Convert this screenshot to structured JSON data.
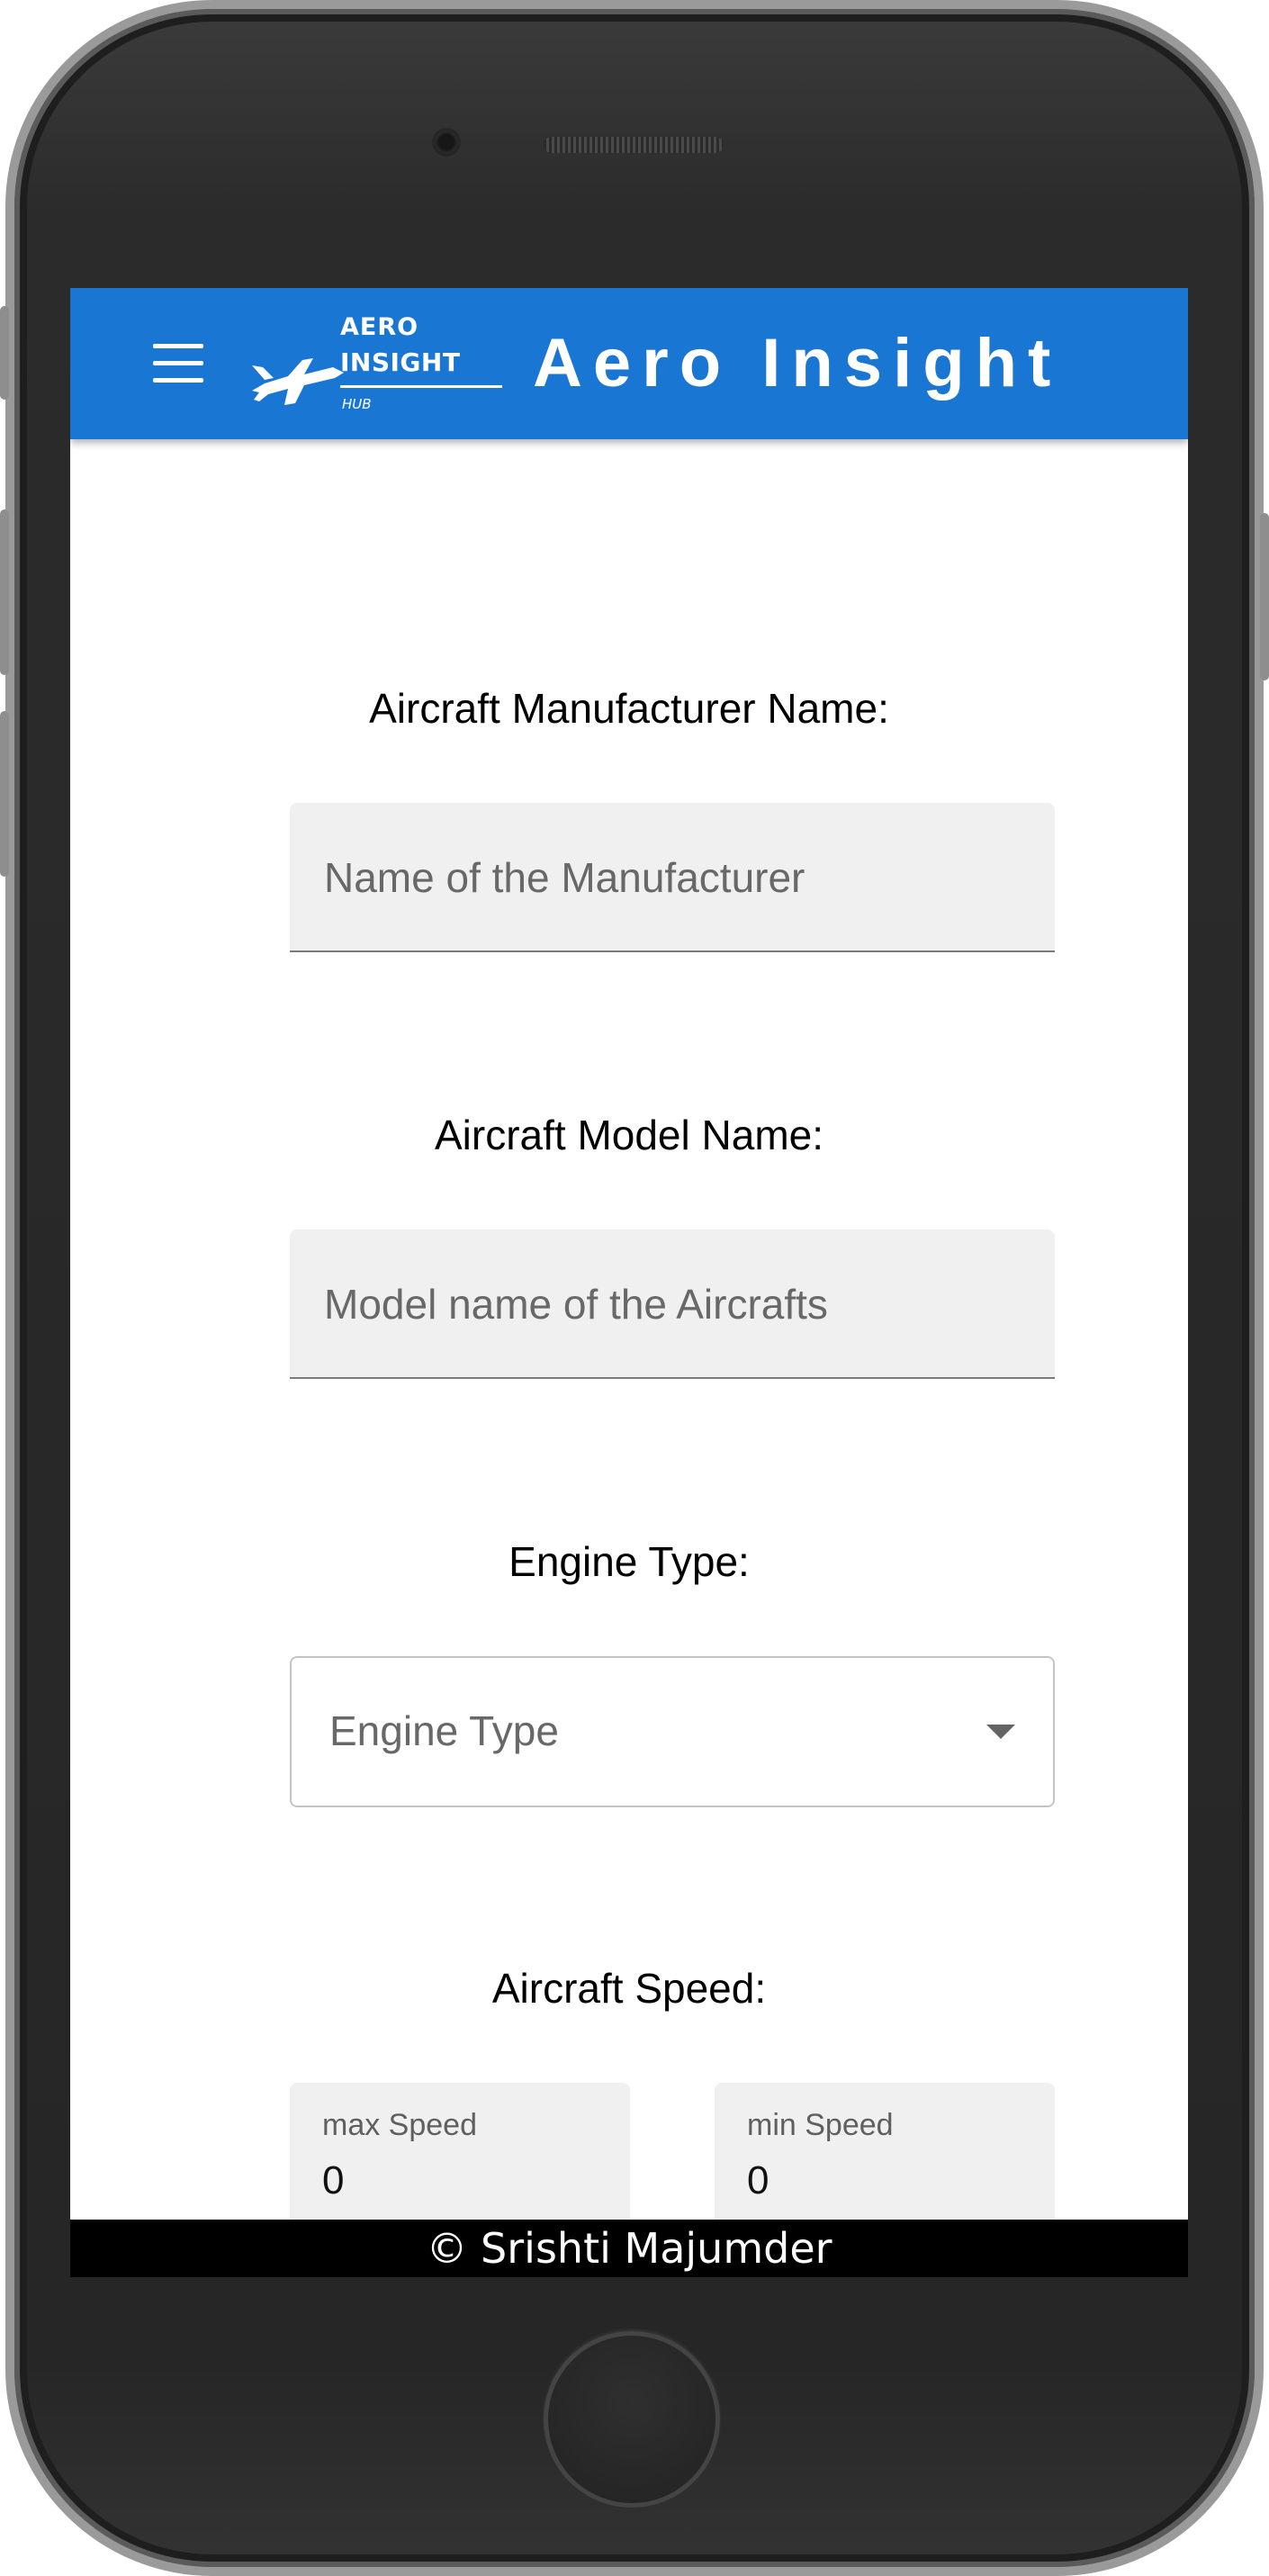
{
  "app": {
    "title": "Aero Insight",
    "logo": {
      "line1": "AERO",
      "line2": "INSIGHT",
      "line3": "HUB"
    },
    "accent_color": "#1976d2"
  },
  "form": {
    "manufacturer": {
      "label": "Aircraft Manufacturer Name:",
      "placeholder": "Name of the Manufacturer"
    },
    "model": {
      "label": "Aircraft Model Name:",
      "placeholder": "Model name of the Aircrafts"
    },
    "engine": {
      "label": "Engine Type:",
      "placeholder": "Engine Type"
    },
    "speed": {
      "label": "Aircraft Speed:",
      "max": {
        "label": "max Speed",
        "value": "0"
      },
      "min": {
        "label": "min Speed",
        "value": "0"
      }
    }
  },
  "footer": {
    "text": "© Srishti Majumder"
  },
  "icons": {
    "menu": "hamburger-menu-icon",
    "dropdown": "caret-down-icon",
    "logo": "airplane-icon"
  }
}
